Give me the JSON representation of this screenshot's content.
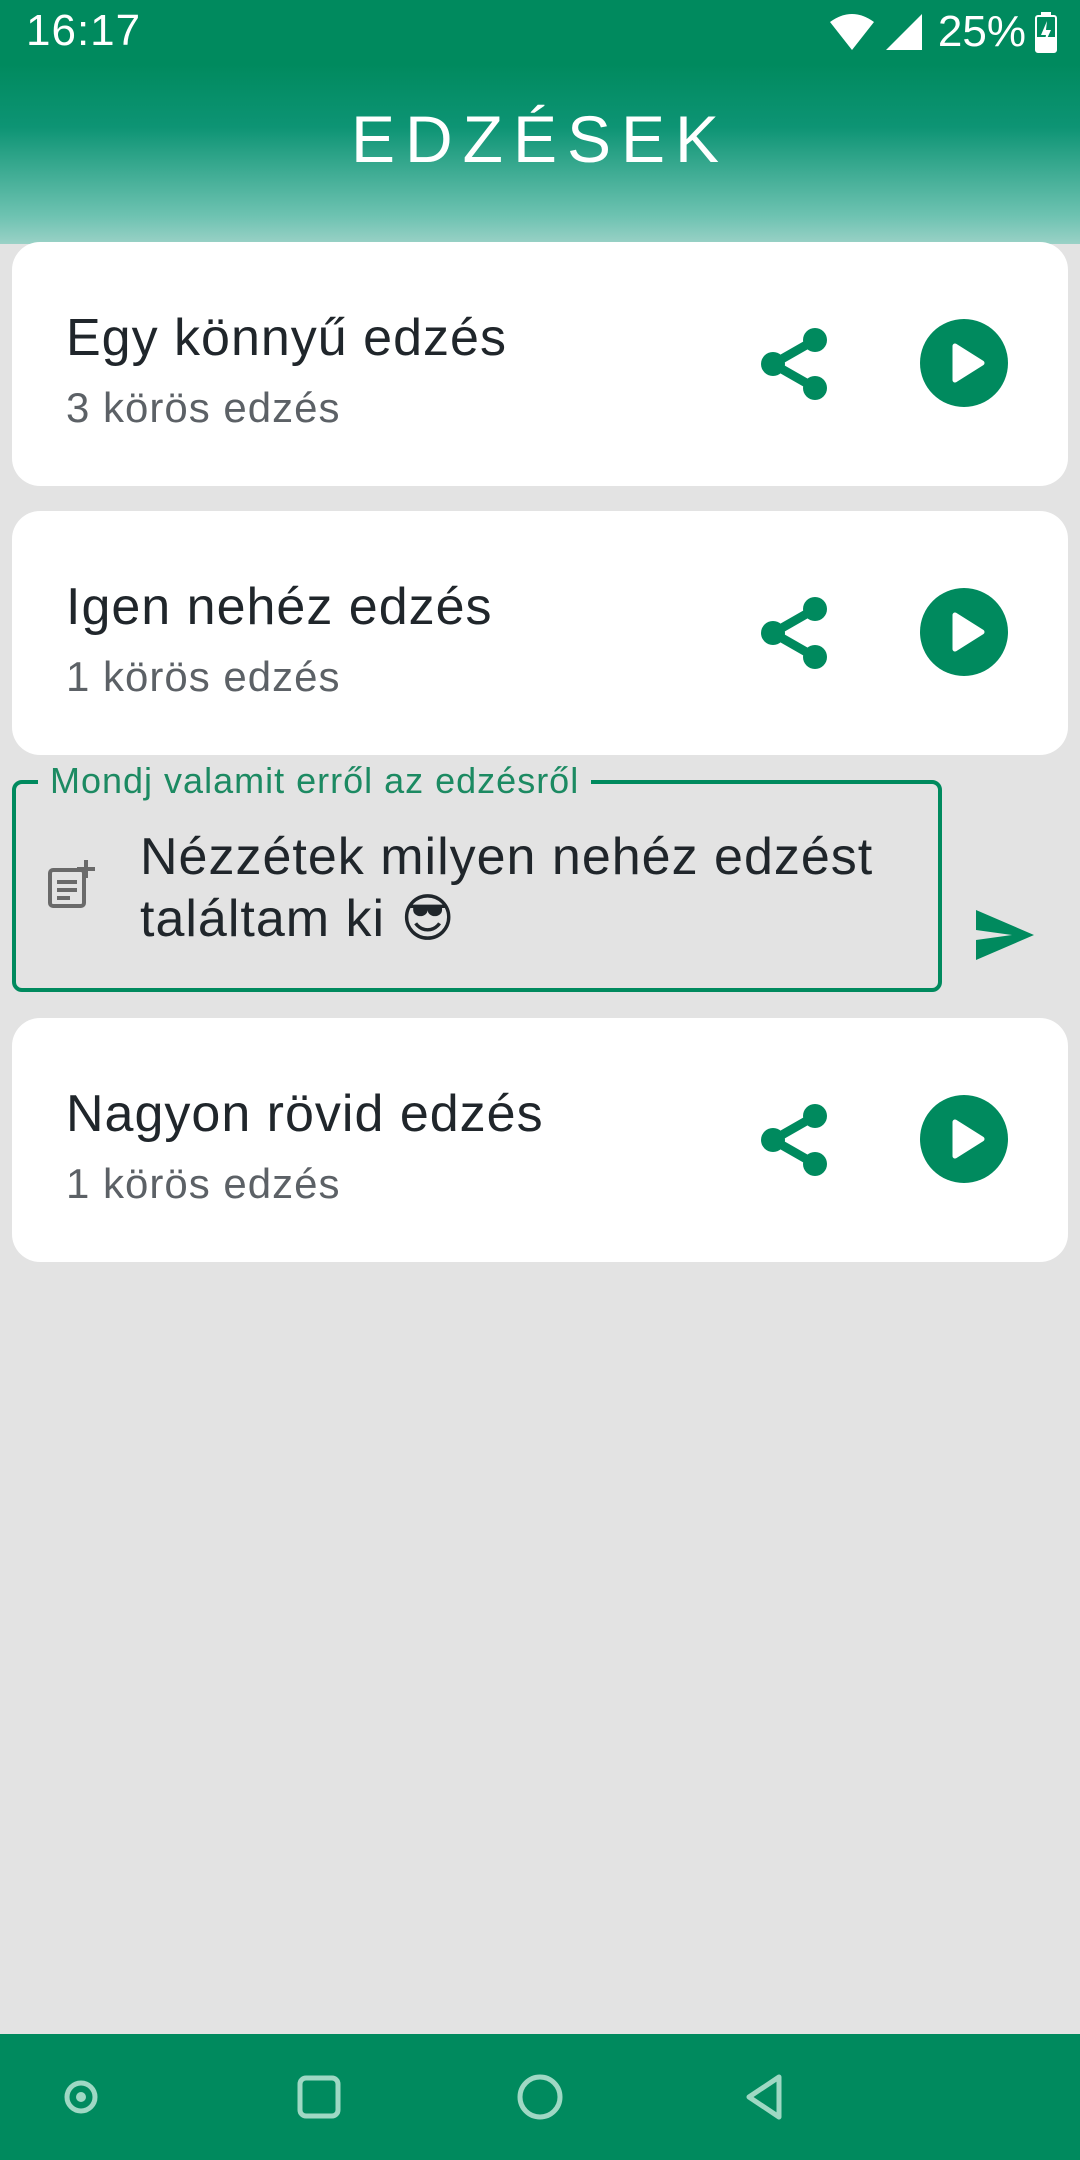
{
  "status": {
    "time": "16:17",
    "battery": "25%"
  },
  "header": {
    "title": "EDZÉSEK"
  },
  "workouts": [
    {
      "name": "Egy könnyű edzés",
      "rounds": "3 körös edzés"
    },
    {
      "name": "Igen nehéz edzés",
      "rounds": "1 körös edzés"
    },
    {
      "name": "Nagyon rövid edzés",
      "rounds": "1 körös edzés"
    }
  ],
  "comment": {
    "label": "Mondj valamit erről az edzésről",
    "text": "Nézzétek milyen nehéz edzést találtam ki 😎"
  },
  "icons": {
    "share": "share-icon",
    "play": "play-icon",
    "send": "send-icon",
    "note": "note-add-icon"
  },
  "colors": {
    "accent": "#008a5e",
    "background": "#e3e3e3",
    "card": "#ffffff"
  }
}
